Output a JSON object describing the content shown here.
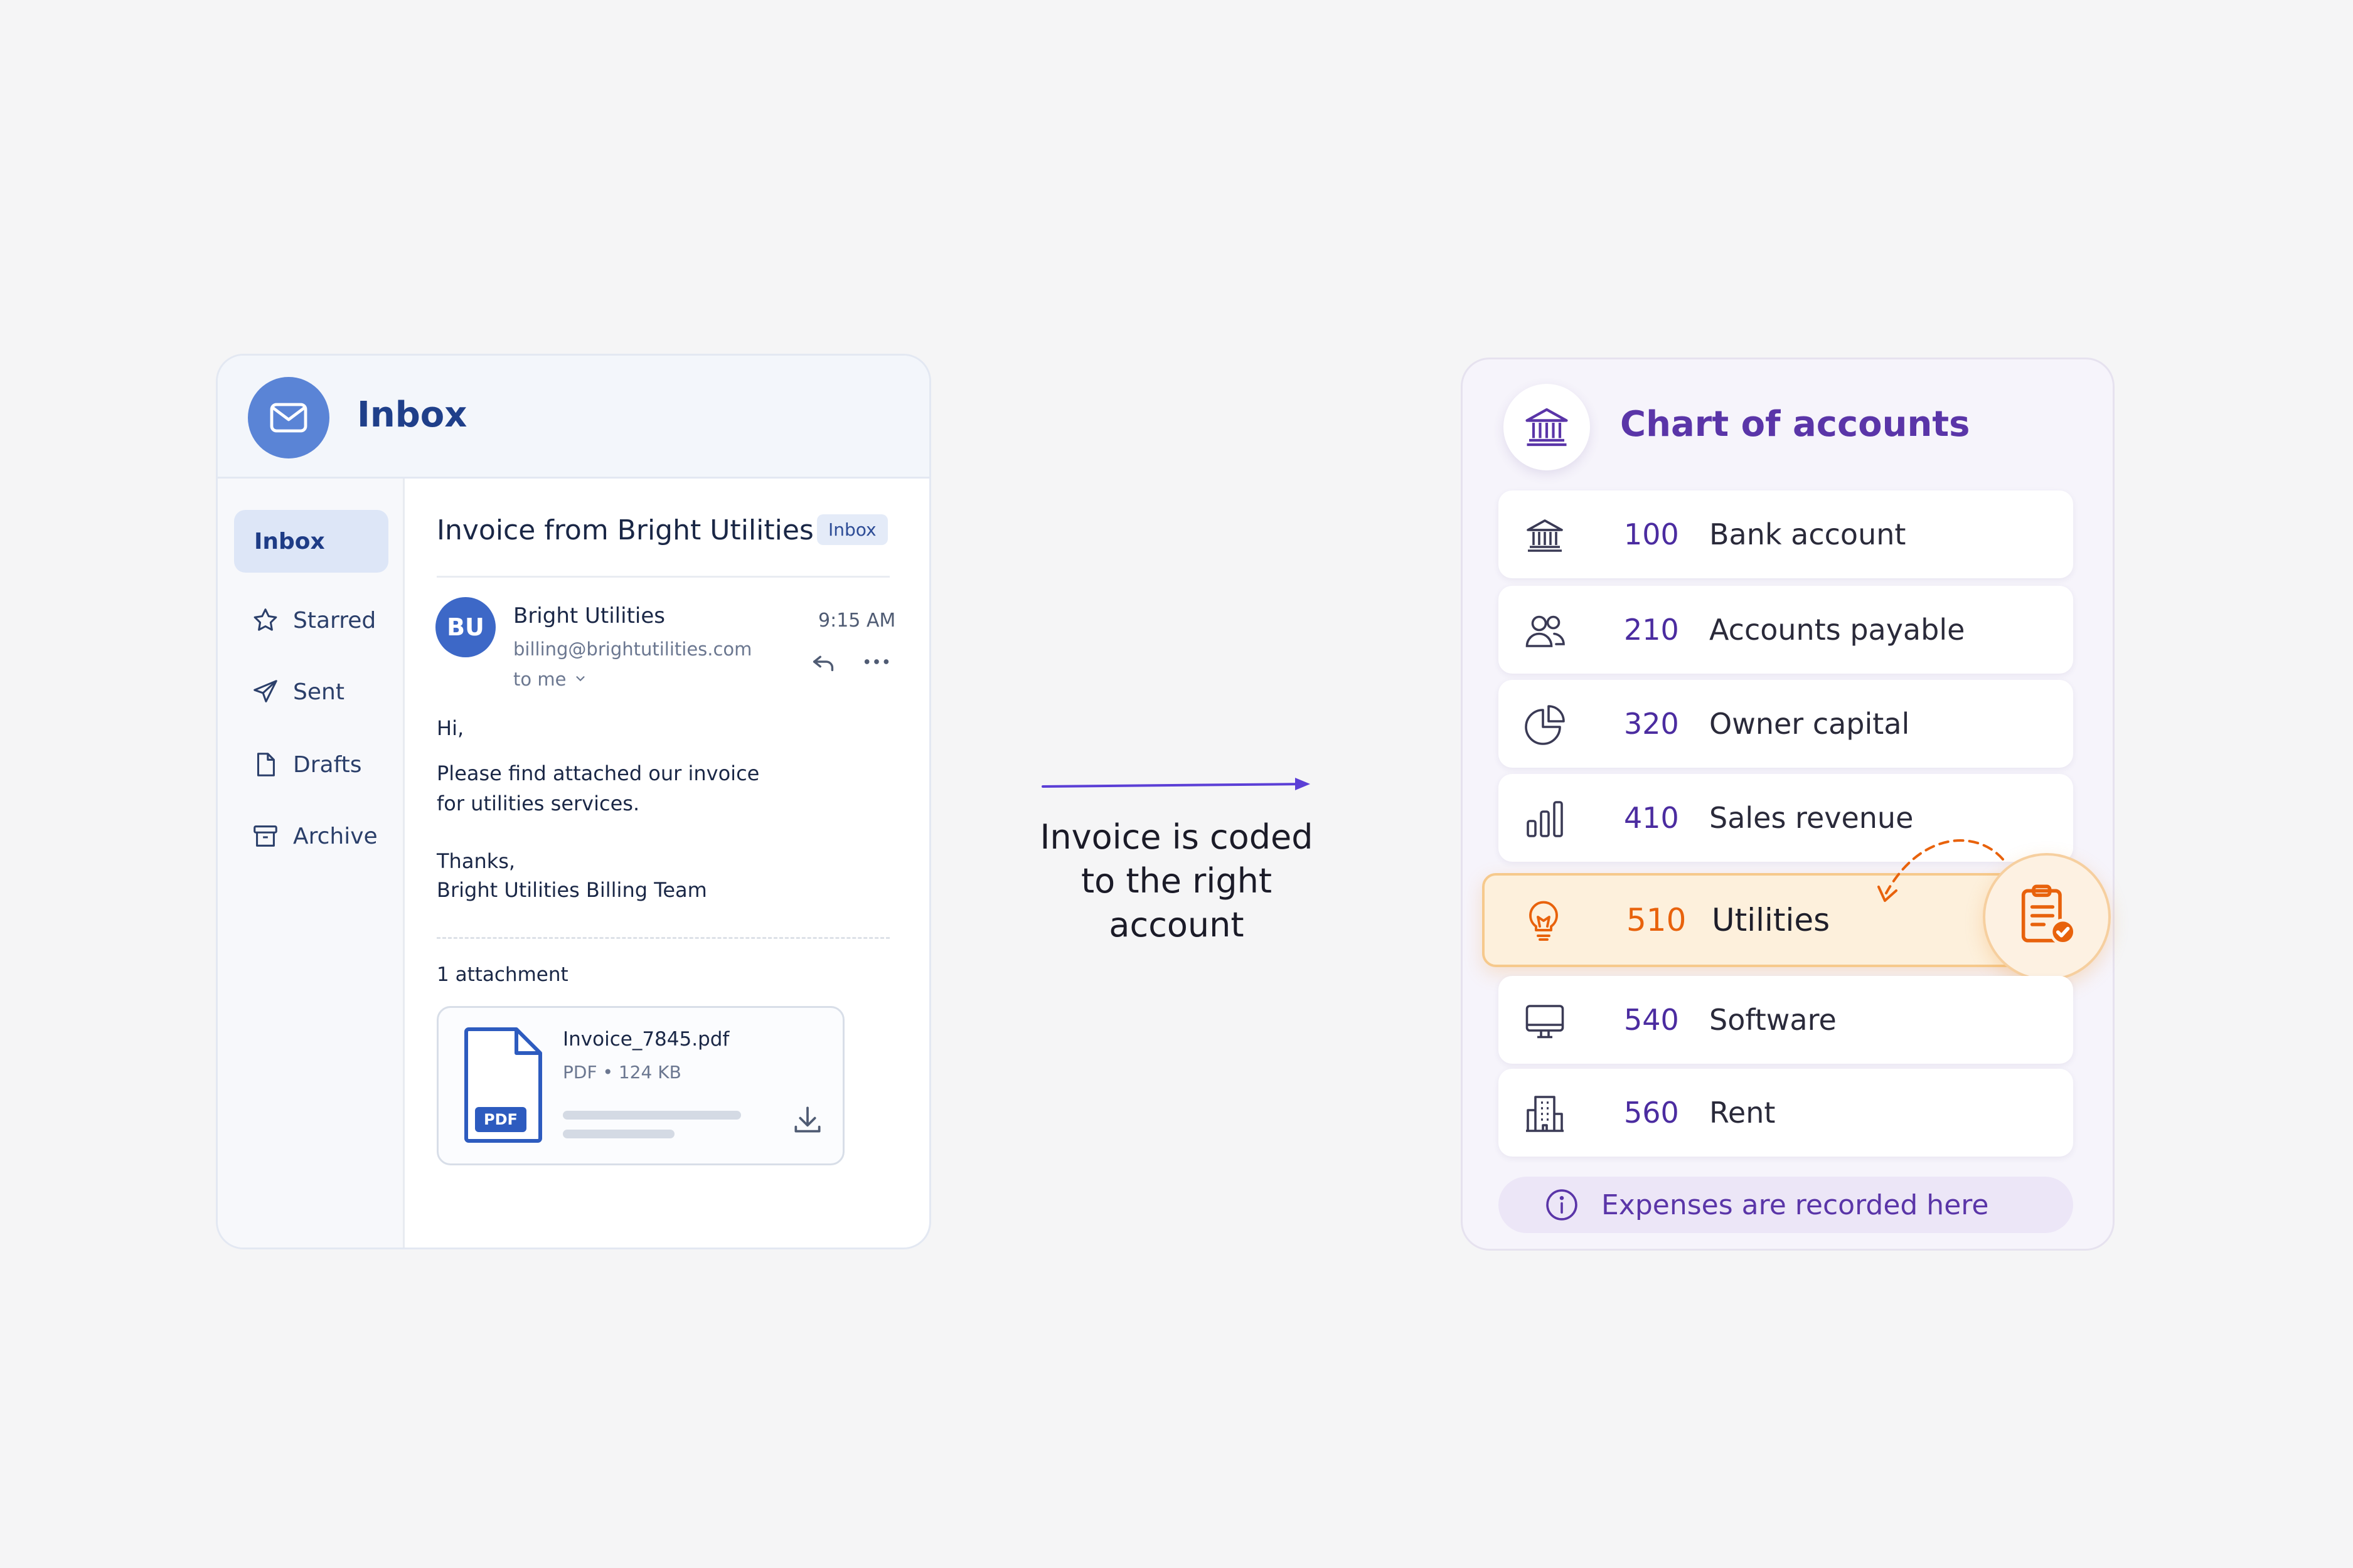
{
  "inbox": {
    "header_title": "Inbox",
    "sidebar": [
      {
        "label": "Inbox",
        "icon": "inbox",
        "active": true
      },
      {
        "label": "Starred",
        "icon": "star-icon"
      },
      {
        "label": "Sent",
        "icon": "send-icon"
      },
      {
        "label": "Drafts",
        "icon": "file-icon"
      },
      {
        "label": "Archive",
        "icon": "archive-icon"
      }
    ],
    "email": {
      "subject": "Invoice from Bright Utilities",
      "badge": "Inbox",
      "sender_initials": "BU",
      "sender_name": "Bright Utilities",
      "sender_email": "billing@brightutilities.com",
      "to": "to me",
      "time": "9:15 AM",
      "greeting": "Hi,",
      "body_line1": "Please find attached our invoice",
      "body_line2": "for utilities services.",
      "signoff": "Thanks,",
      "signature": "Bright Utilities Billing Team",
      "attachment_count": "1 attachment",
      "attachment": {
        "filename": "Invoice_7845.pdf",
        "meta": "PDF • 124 KB",
        "type_label": "PDF"
      }
    }
  },
  "middle": {
    "caption_line1": "Invoice is coded",
    "caption_line2": "to the right",
    "caption_line3": "account",
    "arrow_color": "#5b3fd6"
  },
  "coa": {
    "title": "Chart of accounts",
    "rows": [
      {
        "code": "100",
        "name": "Bank account",
        "icon": "bank-icon"
      },
      {
        "code": "210",
        "name": "Accounts payable",
        "icon": "users-icon"
      },
      {
        "code": "320",
        "name": "Owner capital",
        "icon": "pie-chart-icon"
      },
      {
        "code": "410",
        "name": "Sales revenue",
        "icon": "bar-chart-icon"
      },
      {
        "code": "510",
        "name": "Utilities",
        "icon": "lightbulb-icon",
        "highlight": true
      },
      {
        "code": "540",
        "name": "Software",
        "icon": "monitor-icon"
      },
      {
        "code": "560",
        "name": "Rent",
        "icon": "building-icon"
      }
    ],
    "footer": "Expenses are recorded here",
    "accent_color": "#5a35a8",
    "highlight_color": "#e8620c"
  }
}
